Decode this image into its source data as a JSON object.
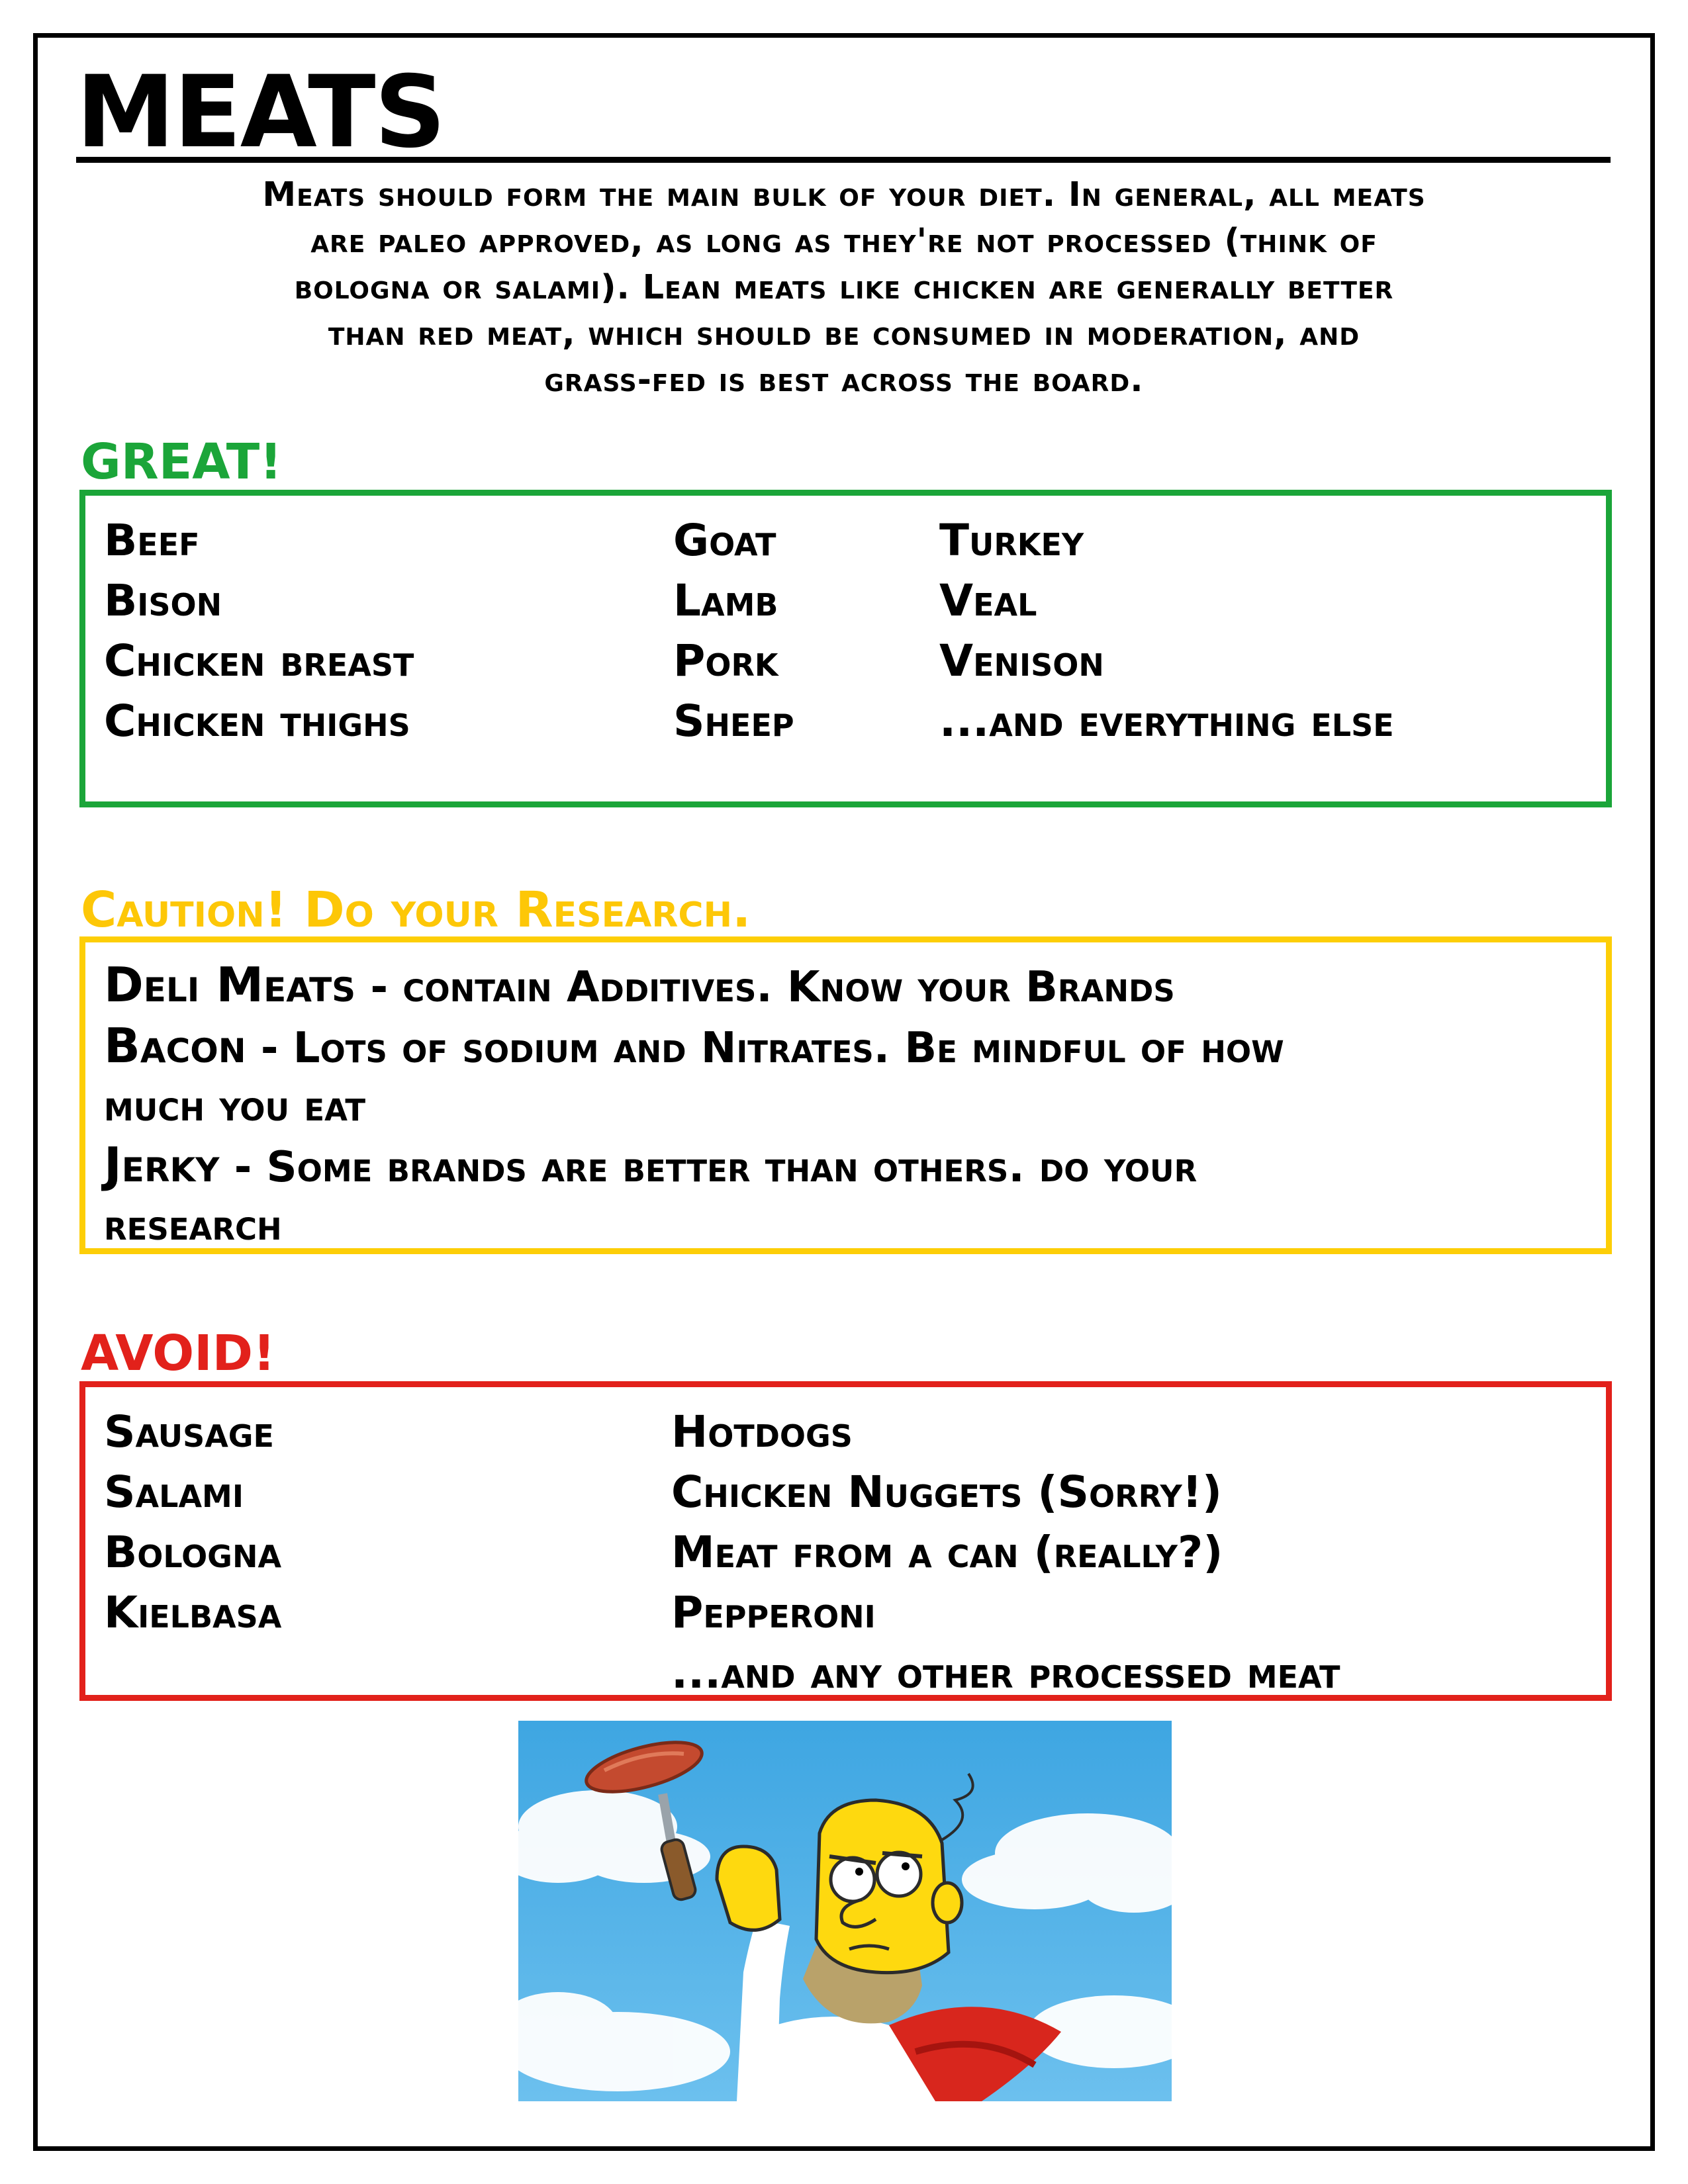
{
  "title": "MEATS",
  "intro": [
    "Meats should form the main bulk of your diet. In general, all meats",
    "are paleo approved, as long as they're not processed (think of",
    "bologna or salami). Lean meats like chicken are generally better",
    "than red meat, which should be consumed in moderation, and",
    "grass-fed is best across the board."
  ],
  "colors": {
    "great": "#1ba539",
    "caution": "#fdce07",
    "caution_text": "#fdc707",
    "avoid": "#e2211b"
  },
  "great": {
    "heading": "GREAT!",
    "col1": [
      "Beef",
      "Bison",
      "Chicken breast",
      "Chicken thighs"
    ],
    "col2": [
      "Goat",
      "Lamb",
      "Pork",
      "Sheep"
    ],
    "col3": [
      "Turkey",
      "Veal",
      "Venison",
      "...and everything else"
    ]
  },
  "caution": {
    "heading": "Caution! Do your Research.",
    "items": [
      {
        "name": "Deli Meats",
        "note": " - contain Additives. Know your Brands"
      },
      {
        "name": "Bacon",
        "note": " - Lots of sodium and Nitrates. Be mindful of how"
      },
      {
        "continuation": "much you eat"
      },
      {
        "name": "Jerky",
        "note": " - Some brands are better than others. do your"
      },
      {
        "continuation": "research"
      }
    ]
  },
  "avoid": {
    "heading": "AVOID!",
    "col1": [
      "Sausage",
      "Salami",
      "Bologna",
      "Kielbasa"
    ],
    "col2": [
      "Hotdogs",
      "Chicken Nuggets (Sorry!)",
      "Meat from a can (really?)",
      "Pepperoni",
      "...and any other processed meat"
    ]
  },
  "illustration": {
    "icon": "cartoon-man-holding-sausage-on-fork"
  }
}
